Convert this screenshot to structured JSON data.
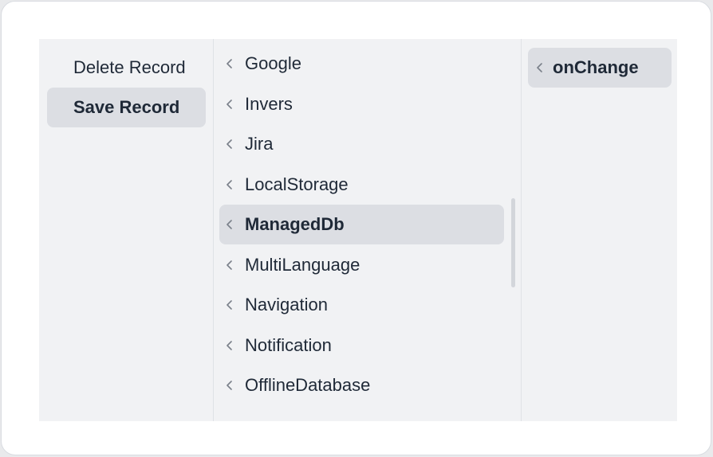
{
  "actions_column": {
    "items": [
      {
        "label": "Delete Record",
        "selected": false
      },
      {
        "label": "Save Record",
        "selected": true
      }
    ]
  },
  "modules_column": {
    "items": [
      {
        "label": "Google",
        "selected": false
      },
      {
        "label": "Invers",
        "selected": false
      },
      {
        "label": "Jira",
        "selected": false
      },
      {
        "label": "LocalStorage",
        "selected": false
      },
      {
        "label": "ManagedDb",
        "selected": true
      },
      {
        "label": "MultiLanguage",
        "selected": false
      },
      {
        "label": "Navigation",
        "selected": false
      },
      {
        "label": "Notification",
        "selected": false
      },
      {
        "label": "OfflineDatabase",
        "selected": false
      }
    ]
  },
  "events_column": {
    "items": [
      {
        "label": "onChange",
        "selected": true
      }
    ]
  },
  "icons": {
    "chevron": "chevron-left-icon"
  }
}
